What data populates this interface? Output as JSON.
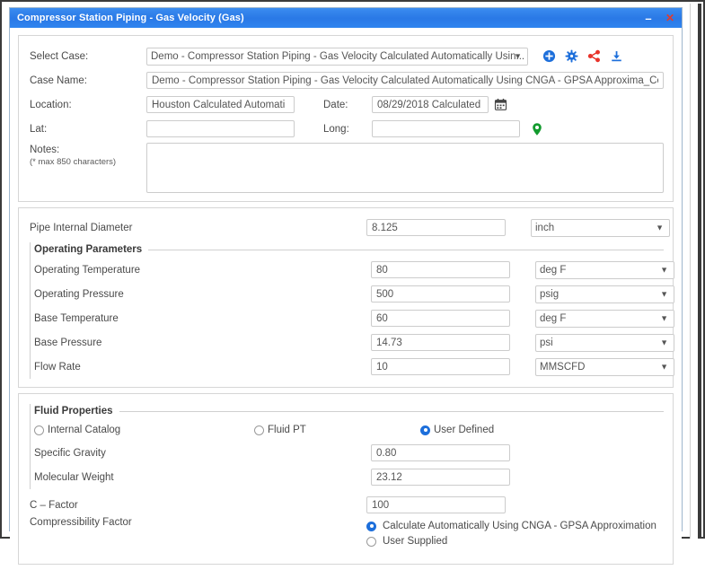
{
  "window": {
    "title": "Compressor Station Piping - Gas Velocity (Gas)",
    "minimize_label": "–",
    "close_label": "✕"
  },
  "case_section": {
    "select_case_label": "Select Case:",
    "select_case_value": "Demo - Compressor Station Piping - Gas Velocity Calculated Automatically Usin...",
    "case_name_label": "Case Name:",
    "case_name_value": "Demo - Compressor Station Piping - Gas Velocity Calculated Automatically Using CNGA - GPSA Approxima_Copy",
    "location_label": "Location:",
    "location_value": "Houston Calculated Automati",
    "date_label": "Date:",
    "date_value": "08/29/2018 Calculated",
    "lat_label": "Lat:",
    "lat_value": "",
    "lat_placeholder": "",
    "long_label": "Long:",
    "long_value": "",
    "long_placeholder": "",
    "notes_label": "Notes:",
    "notes_sublabel": "(* max 850 characters)",
    "notes_value": "",
    "notes_placeholder": "",
    "tools": [
      {
        "name": "add-case-icon",
        "title": "Add Case"
      },
      {
        "name": "settings-gear-icon",
        "title": "Settings"
      },
      {
        "name": "share-icon",
        "title": "Share"
      },
      {
        "name": "download-icon",
        "title": "Download"
      }
    ],
    "date_picker_icon": "calendar-icon",
    "map_pin_icon": "map-pin-icon"
  },
  "parameters": {
    "pipe_diameter": {
      "label": "Pipe Internal Diameter",
      "value": "8.125",
      "unit": "inch"
    },
    "operating_group_legend": "Operating Parameters",
    "rows": [
      {
        "label": "Operating Temperature",
        "value": "80",
        "unit": "deg F"
      },
      {
        "label": "Operating Pressure",
        "value": "500",
        "unit": "psig"
      },
      {
        "label": "Base Temperature",
        "value": "60",
        "unit": "deg F"
      },
      {
        "label": "Base Pressure",
        "value": "14.73",
        "unit": "psi"
      },
      {
        "label": "Flow Rate",
        "value": "10",
        "unit": "MMSCFD"
      }
    ]
  },
  "fluid": {
    "legend": "Fluid Properties",
    "options": [
      {
        "label": "Internal Catalog",
        "selected": false
      },
      {
        "label": "Fluid PT",
        "selected": false
      },
      {
        "label": "User Defined",
        "selected": true
      }
    ],
    "specific_gravity_label": "Specific Gravity",
    "specific_gravity_value": "0.80",
    "molecular_weight_label": "Molecular Weight",
    "molecular_weight_value": "23.12"
  },
  "bottom": {
    "c_factor_label": "C – Factor",
    "c_factor_value": "100",
    "compressibility_label": "Compressibility Factor",
    "compressibility_options": [
      {
        "label": "Calculate Automatically Using CNGA - GPSA Approximation",
        "selected": true
      },
      {
        "label": "User Supplied",
        "selected": false
      }
    ]
  },
  "colors": {
    "titlebar": "#2a7ae8",
    "close_red": "#e23b2e",
    "accent_blue": "#1d6fdb",
    "share_red": "#e8332a",
    "pin_green": "#139b2e",
    "panel_border": "#d6d6d6"
  }
}
